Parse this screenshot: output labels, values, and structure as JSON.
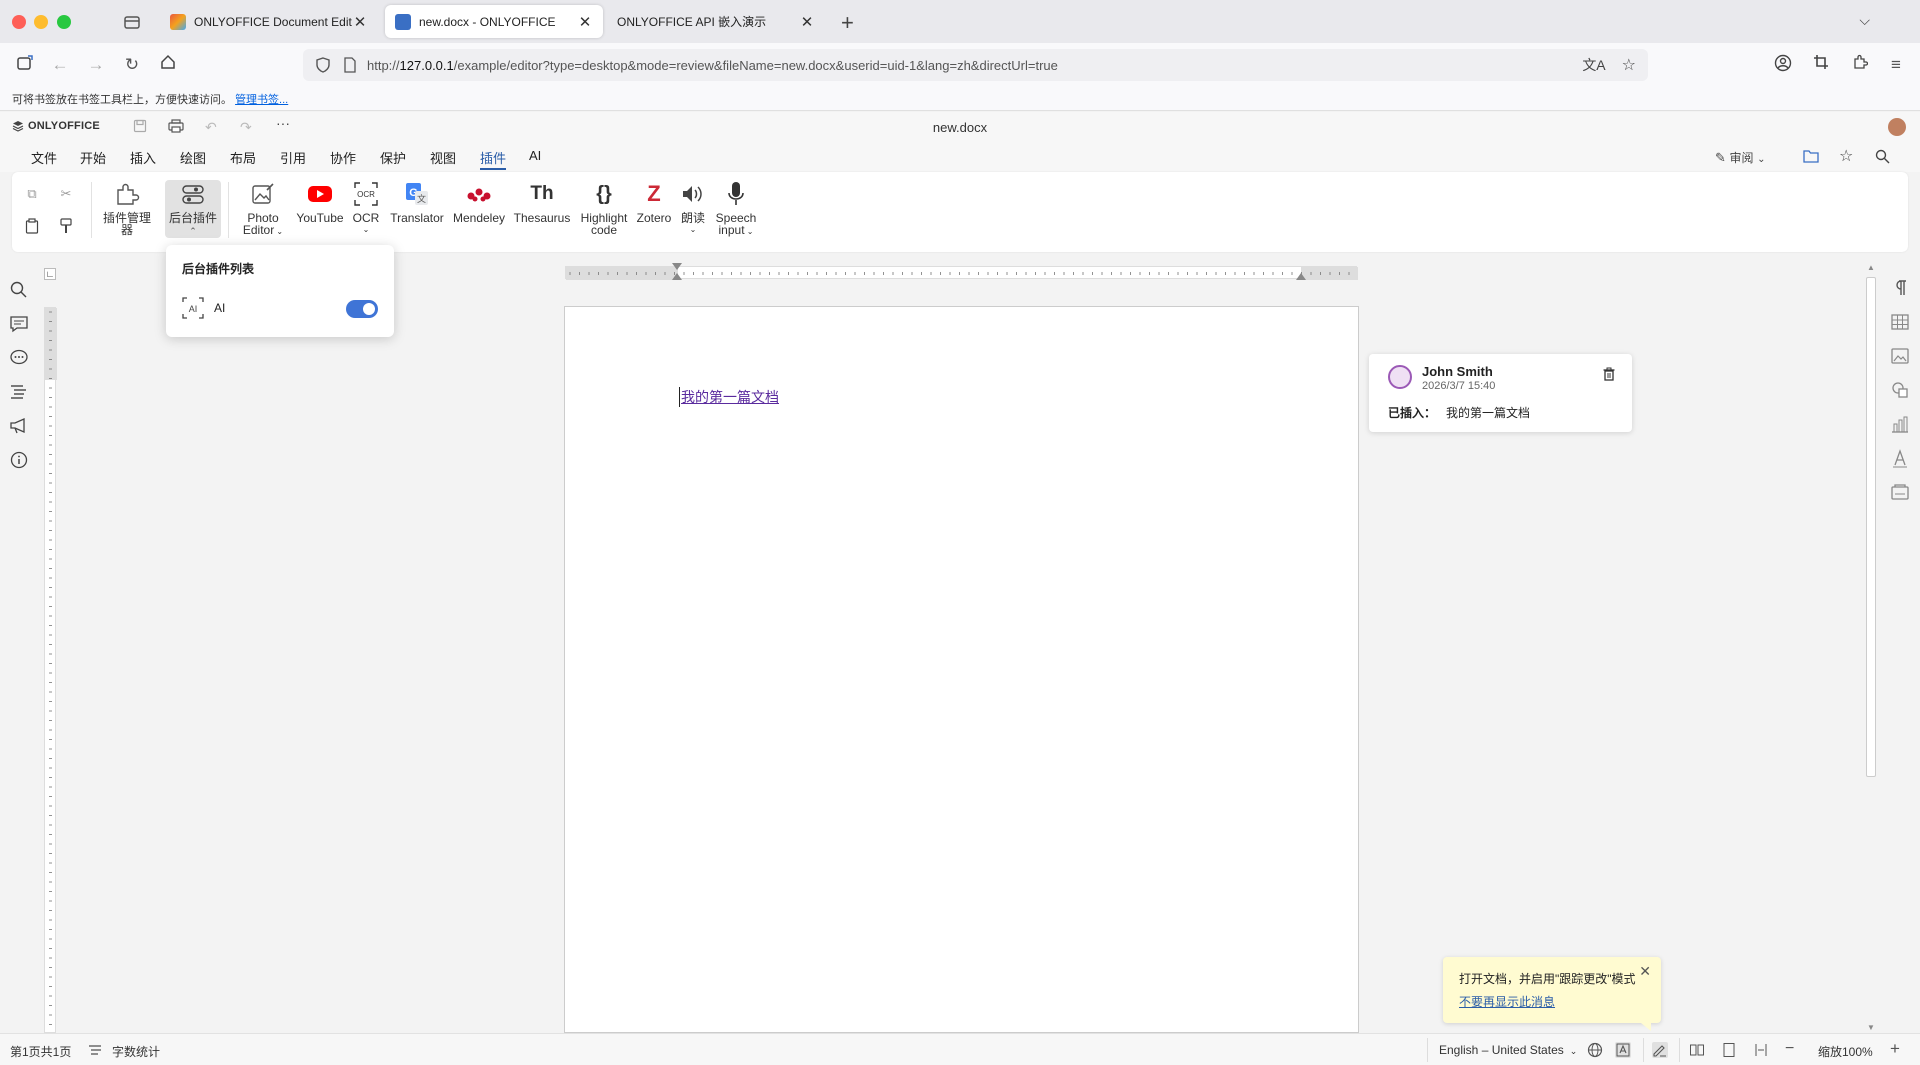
{
  "browser": {
    "tabs": [
      {
        "title": "ONLYOFFICE Document Editors",
        "active": false
      },
      {
        "title": "new.docx - ONLYOFFICE",
        "active": true
      },
      {
        "title": "ONLYOFFICE API 嵌入演示",
        "active": false
      }
    ],
    "url_host": "127.0.0.1",
    "url_prefix": "http://",
    "url_rest": "/example/editor?type=desktop&mode=review&fileName=new.docx&userid=uid-1&lang=zh&directUrl=true",
    "bookmark_hint": "可将书签放在书签工具栏上，方便快速访问。",
    "bookmark_link": "管理书签..."
  },
  "editor": {
    "logo": "ONLYOFFICE",
    "doc_title": "new.docx",
    "menu": [
      "文件",
      "开始",
      "插入",
      "绘图",
      "布局",
      "引用",
      "协作",
      "保护",
      "视图",
      "插件",
      "AI"
    ],
    "active_menu": "插件",
    "review_label": "审阅"
  },
  "toolbar": {
    "plugin_manager": "插件管理器",
    "background_plugins": "后台插件",
    "plugins": [
      {
        "label1": "Photo",
        "label2": "Editor",
        "arrow": true
      },
      {
        "label1": "YouTube",
        "label2": "",
        "arrow": false
      },
      {
        "label1": "OCR",
        "label2": "",
        "arrow": true
      },
      {
        "label1": "Translator",
        "label2": "",
        "arrow": false
      },
      {
        "label1": "Mendeley",
        "label2": "",
        "arrow": false
      },
      {
        "label1": "Thesaurus",
        "label2": "",
        "arrow": false
      },
      {
        "label1": "Highlight",
        "label2": "code",
        "arrow": false
      },
      {
        "label1": "Zotero",
        "label2": "",
        "arrow": false
      },
      {
        "label1": "朗读",
        "label2": "",
        "arrow": true
      },
      {
        "label1": "Speech",
        "label2": "input",
        "arrow": true
      }
    ],
    "icon_texts": {
      "ocr": "OCR",
      "thesaurus": "Th",
      "highlight": "{}",
      "zotero": "Z"
    }
  },
  "popup": {
    "title": "后台插件列表",
    "item_label": "AI",
    "item_icon_text": "AI",
    "enabled": true
  },
  "document": {
    "text": "我的第一篇文档"
  },
  "comment": {
    "author": "John Smith",
    "date": "2026/3/7 15:40",
    "action": "已插入：",
    "content": "我的第一篇文档"
  },
  "notice": {
    "text": "打开文档，并启用\"跟踪更改\"模式",
    "link": "不要再显示此消息"
  },
  "status": {
    "page": "第1页共1页",
    "word_count": "字数统计",
    "language": "English – United States",
    "zoom": "缩放100%"
  },
  "colors": {
    "accent": "#2a5da8",
    "toggle_on": "#3f74d6",
    "insert_text": "#5a2b9e",
    "youtube": "#ff0000",
    "mendeley": "#c8102e",
    "zotero": "#cc2936",
    "notice_bg": "#fffbd1"
  }
}
